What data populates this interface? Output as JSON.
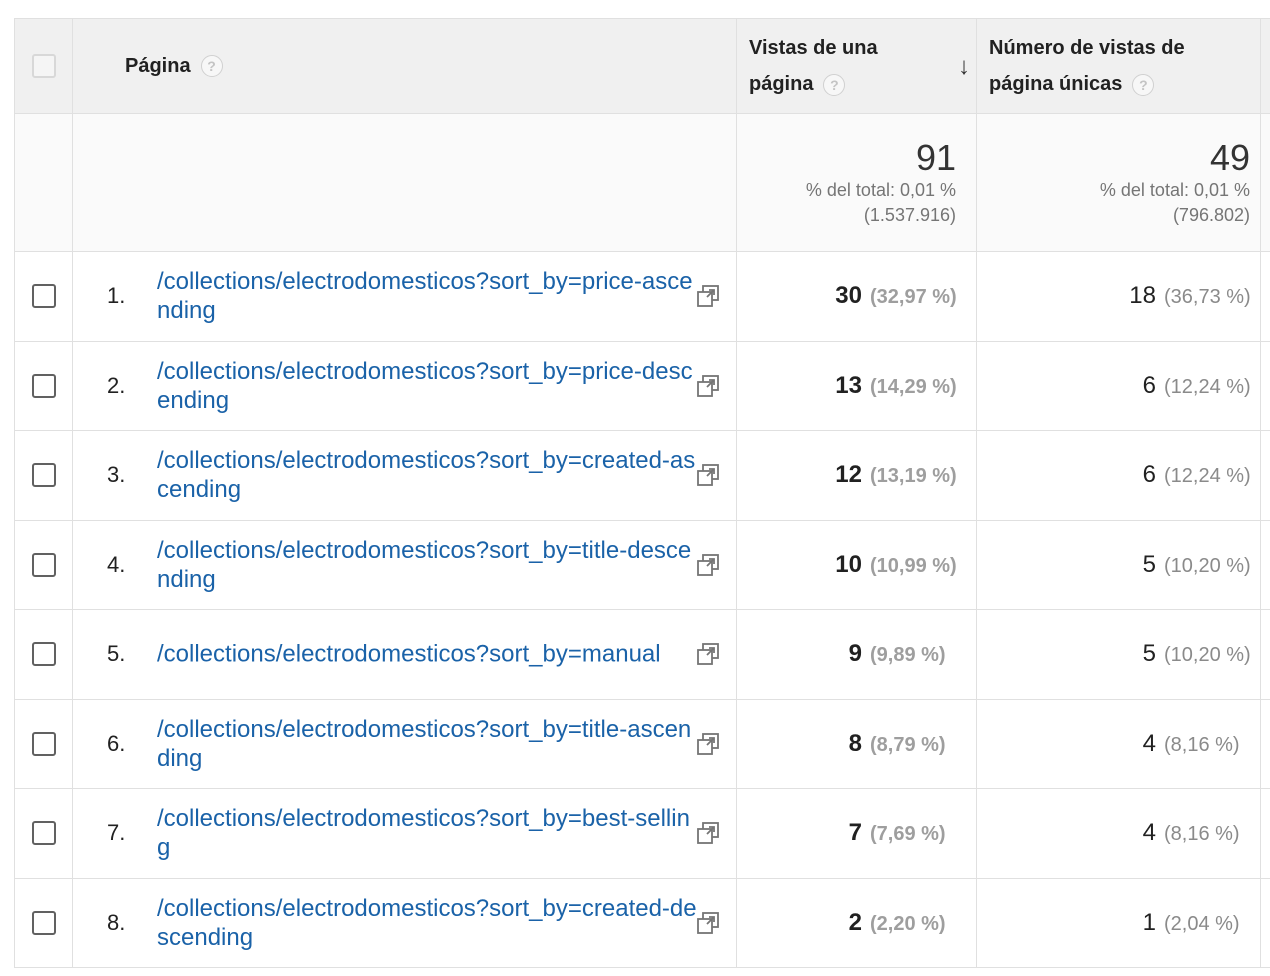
{
  "header": {
    "page_label": "Página",
    "views_label_line1": "Vistas de una",
    "views_label_line2": "página",
    "unique_label_line1": "Número de vistas de",
    "unique_label_line2": "página únicas",
    "help_glyph": "?",
    "sort_glyph": "↓"
  },
  "totals": {
    "views": {
      "value": "91",
      "pct": "% del total: 0,01 %",
      "total": "(1.537.916)"
    },
    "unique": {
      "value": "49",
      "pct": "% del total: 0,01 %",
      "total": "(796.802)"
    }
  },
  "rows": [
    {
      "rank": "1.",
      "page": "/collections/electrodomesticos?sort_by=price-ascending",
      "views": "30",
      "views_pct": "(32,97 %)",
      "unique": "18",
      "unique_pct": "(36,73 %)"
    },
    {
      "rank": "2.",
      "page": "/collections/electrodomesticos?sort_by=price-descending",
      "views": "13",
      "views_pct": "(14,29 %)",
      "unique": "6",
      "unique_pct": "(12,24 %)"
    },
    {
      "rank": "3.",
      "page": "/collections/electrodomesticos?sort_by=created-ascending",
      "views": "12",
      "views_pct": "(13,19 %)",
      "unique": "6",
      "unique_pct": "(12,24 %)"
    },
    {
      "rank": "4.",
      "page": "/collections/electrodomesticos?sort_by=title-descending",
      "views": "10",
      "views_pct": "(10,99 %)",
      "unique": "5",
      "unique_pct": "(10,20 %)"
    },
    {
      "rank": "5.",
      "page": "/collections/electrodomesticos?sort_by=manual",
      "views": "9",
      "views_pct": "(9,89 %)",
      "unique": "5",
      "unique_pct": "(10,20 %)"
    },
    {
      "rank": "6.",
      "page": "/collections/electrodomesticos?sort_by=title-ascending",
      "views": "8",
      "views_pct": "(8,79 %)",
      "unique": "4",
      "unique_pct": "(8,16 %)"
    },
    {
      "rank": "7.",
      "page": "/collections/electrodomesticos?sort_by=best-selling",
      "views": "7",
      "views_pct": "(7,69 %)",
      "unique": "4",
      "unique_pct": "(8,16 %)"
    },
    {
      "rank": "8.",
      "page": "/collections/electrodomesticos?sort_by=created-descending",
      "views": "2",
      "views_pct": "(2,20 %)",
      "unique": "1",
      "unique_pct": "(2,04 %)"
    }
  ],
  "icons": {
    "row_action": "open-in-new-window-icon",
    "sort": "arrow-down-icon",
    "help": "help-icon"
  },
  "colors": {
    "link": "#1a62a8",
    "header_bg": "#f0f0f0",
    "muted": "#8a8a8a"
  }
}
